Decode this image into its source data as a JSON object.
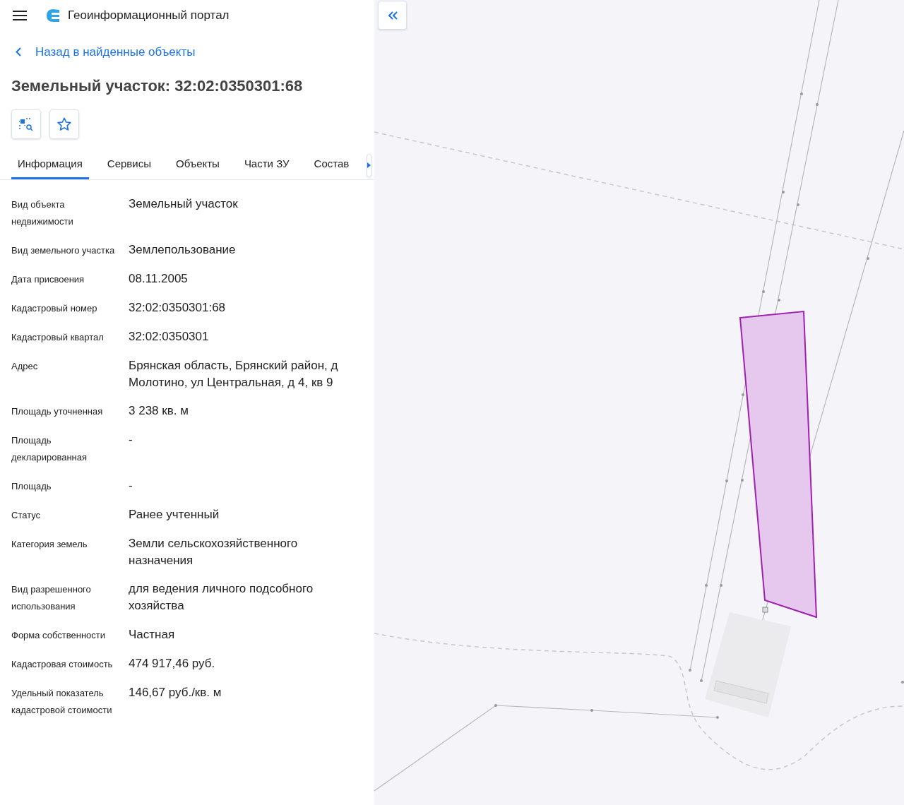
{
  "header": {
    "title": "Геоинформационный портал"
  },
  "back_link": "Назад в найденные объекты",
  "object_title": "Земельный участок: 32:02:0350301:68",
  "tabs": [
    {
      "label": "Информация",
      "selected": true
    },
    {
      "label": "Сервисы",
      "selected": false
    },
    {
      "label": "Объекты",
      "selected": false
    },
    {
      "label": "Части ЗУ",
      "selected": false
    },
    {
      "label": "Состав",
      "selected": false
    }
  ],
  "properties": [
    {
      "label": "Вид объекта недвижимости",
      "value": "Земельный участок"
    },
    {
      "label": "Вид земельного участка",
      "value": "Землепользование"
    },
    {
      "label": "Дата присвоения",
      "value": "08.11.2005"
    },
    {
      "label": "Кадастровый номер",
      "value": "32:02:0350301:68"
    },
    {
      "label": "Кадастровый квартал",
      "value": "32:02:0350301"
    },
    {
      "label": "Адрес",
      "value": "Брянская область, Брянский район, д Молотино, ул Центральная, д 4, кв 9"
    },
    {
      "label": "Площадь уточненная",
      "value": "3 238 кв. м"
    },
    {
      "label": "Площадь декларированная",
      "value": "-"
    },
    {
      "label": "Площадь",
      "value": "-"
    },
    {
      "label": "Статус",
      "value": "Ранее учтенный"
    },
    {
      "label": "Категория земель",
      "value": "Земли сельскохозяйственного назначения"
    },
    {
      "label": "Вид разрешенного использования",
      "value": "для ведения личного подсобного хозяйства"
    },
    {
      "label": "Форма собственности",
      "value": "Частная"
    },
    {
      "label": "Кадастровая стоимость",
      "value": "474 917,46 руб."
    },
    {
      "label": "Удельный показатель кадастровой стоимости",
      "value": "146,67 руб./кв. м"
    }
  ]
}
